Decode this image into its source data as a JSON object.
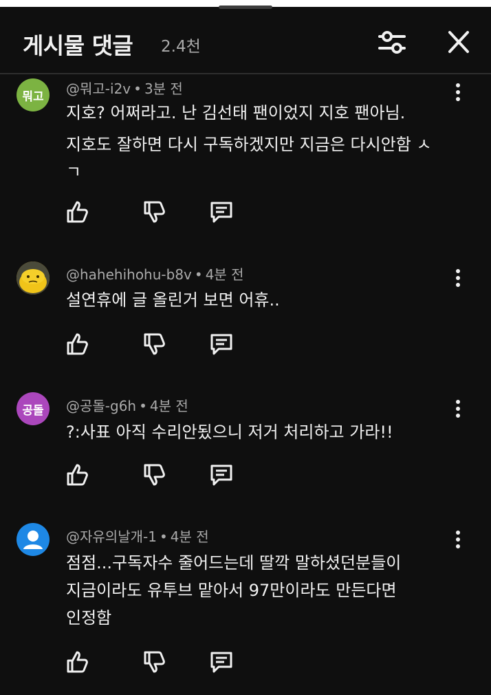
{
  "header": {
    "title": "게시물 댓글",
    "count": "2.4천"
  },
  "icons": {
    "filter": "tune-sliders-icon",
    "close": "close-icon",
    "more": "more-vertical-icon",
    "like": "thumb-up-icon",
    "dislike": "thumb-down-icon",
    "reply": "comment-reply-icon"
  },
  "comments": [
    {
      "avatar_text": "뭐고",
      "avatar_color": "#7cb342",
      "author": "@뭐고-i2v",
      "time": "3분 전",
      "lines": [
        "지호? 어쩌라고. 난 김선태 팬이었지 지호 팬아님.",
        "지호도 잘하면 다시 구독하겠지만 지금은 다시안함 ㅅ",
        "ㄱ"
      ]
    },
    {
      "avatar_text": "",
      "avatar_color": "#e8b923",
      "author": "@hahehihohu-b8v",
      "time": "4분 전",
      "lines": [
        "설연휴에 글 올린거 보면 어휴.."
      ]
    },
    {
      "avatar_text": "공돌",
      "avatar_color": "#ab47bc",
      "author": "@공돌-g6h",
      "time": "4분 전",
      "lines": [
        "?:사표 아직 수리안됬으니 저거 처리하고 가라!!"
      ]
    },
    {
      "avatar_text": "",
      "avatar_color": "#1e88e5",
      "author": "@자유의날개-1",
      "time": "4분 전",
      "lines": [
        "점점...구독자수 줄어드는데 딸깍 말하셨던분들이",
        "지금이라도 유투브 맡아서 97만이라도 만든다면",
        "인정함"
      ]
    }
  ]
}
